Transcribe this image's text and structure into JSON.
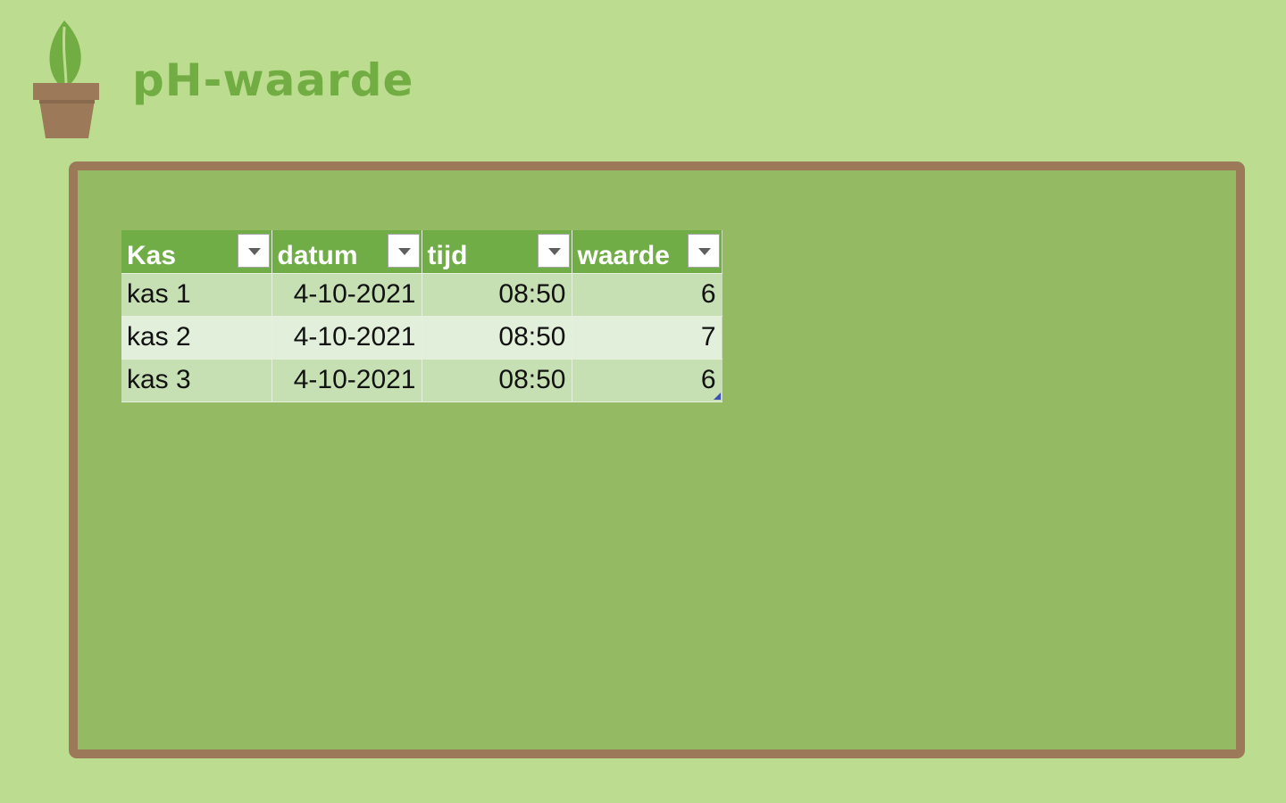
{
  "title": "pH-waarde",
  "icons": {
    "logo": "plant-pot-icon",
    "filter": "filter-dropdown-icon"
  },
  "colors": {
    "background": "#bcdd8f",
    "board": "#94bb63",
    "board_border": "#9c7959",
    "title": "#72ad43",
    "table_header": "#70ad47",
    "row_odd": "#c6e0b4",
    "row_even": "#e2efda"
  },
  "table": {
    "headers": [
      "Kas",
      "datum",
      "tijd",
      "waarde"
    ],
    "rows": [
      [
        "kas 1",
        "4-10-2021",
        "08:50",
        "6"
      ],
      [
        "kas 2",
        "4-10-2021",
        "08:50",
        "7"
      ],
      [
        "kas 3",
        "4-10-2021",
        "08:50",
        "6"
      ]
    ]
  }
}
